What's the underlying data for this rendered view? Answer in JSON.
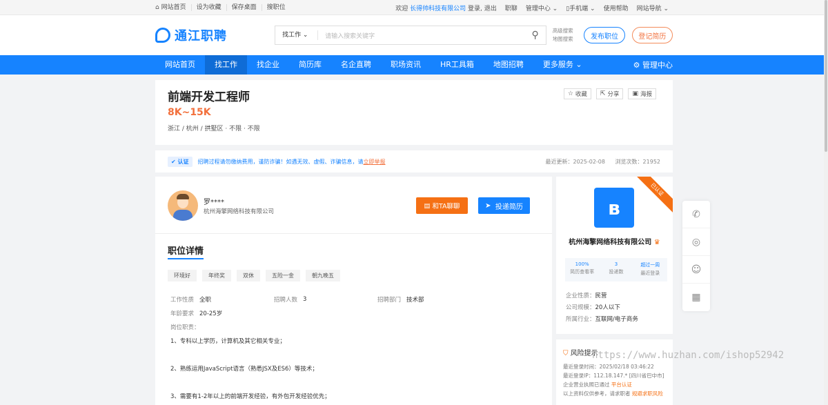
{
  "topbar": {
    "left": [
      "⌂ 网站首页",
      "设为收藏",
      "保存桌面",
      "搜职位"
    ],
    "welcome": "欢迎",
    "company": "长得帅科技有限公司",
    "login": "登录",
    "logout": "退出",
    "right": [
      "职聊",
      "管理中心 ⌄",
      "▯手机端 ⌄",
      "使用帮助",
      "网站导航 ⌄"
    ]
  },
  "header": {
    "logo": "通江职聘",
    "search_type": "找工作 ⌄",
    "search_placeholder": "请输入搜索关键字",
    "adv1": "高级搜索",
    "adv2": "地图搜索",
    "post_job": "发布职位",
    "register_resume": "登记简历"
  },
  "nav": {
    "items": [
      "网站首页",
      "找工作",
      "找企业",
      "简历库",
      "名企直聘",
      "职场资讯",
      "HR工具箱",
      "地图招聘",
      "更多服务 ⌄"
    ],
    "manage": "管理中心"
  },
  "job": {
    "title": "前端开发工程师",
    "salary": "8K~15K",
    "location": "浙江 / 杭州 / 拱墅区 · 不限 · 不限",
    "actions": [
      "收藏",
      "分享",
      "海报"
    ]
  },
  "notice": {
    "badge": "认证",
    "text": "招聘过程请勿缴纳费用，谨防诈骗！如遇无效、虚假、诈骗信息，请",
    "report": "立即举报",
    "updated": "最近更新：2025-02-08",
    "views": "浏览次数：21952"
  },
  "contact": {
    "name": "罗****",
    "company": "杭州海擎网络科技有限公司",
    "chat": "和TA聊聊",
    "apply": "投递简历"
  },
  "detail": {
    "title": "职位详情",
    "tags": [
      "环境好",
      "年终奖",
      "双休",
      "五险一金",
      "朝九晚五"
    ],
    "fields": [
      {
        "k": "工作性质",
        "v": "全职"
      },
      {
        "k": "招聘人数",
        "v": "3"
      },
      {
        "k": "招聘部门",
        "v": "技术部"
      },
      {
        "k": "年龄要求",
        "v": "20-25岁"
      }
    ],
    "duty_label": "岗位职责：",
    "duties": [
      "1、专科以上学历，计算机及其它相关专业；",
      "2、熟练运用JavaScript语言（熟悉JSX及ES6）等技术；",
      "3、需要有1-2年以上的前端开发经验，有外包开发经验优先；"
    ]
  },
  "company": {
    "ribbon": "已认证",
    "name": "杭州海擎网络科技有限公司",
    "stats": [
      {
        "v": "100%",
        "k": "简历查看率"
      },
      {
        "v": "3",
        "k": "投递数"
      },
      {
        "v": "超过一周",
        "k": "最近登录"
      }
    ],
    "info": [
      {
        "k": "企业性质：",
        "v": "民营"
      },
      {
        "k": "公司规模：",
        "v": "20人以下"
      },
      {
        "k": "所属行业：",
        "v": "互联网/电子商务"
      }
    ]
  },
  "risk": {
    "title": "风险提示",
    "login_time": "最近登录时间：2025/02/18 03:46:22",
    "login_ip": "最近登录IP：112.18.147.* [四川省巴中市]",
    "license": "企业营业执照已通过",
    "license_hl": "平台认证",
    "tip": "以上资料仅供参考，请求职者",
    "tip_hl": "规避求职风险"
  },
  "watermark": "https://www.huzhan.com/ishop52942"
}
